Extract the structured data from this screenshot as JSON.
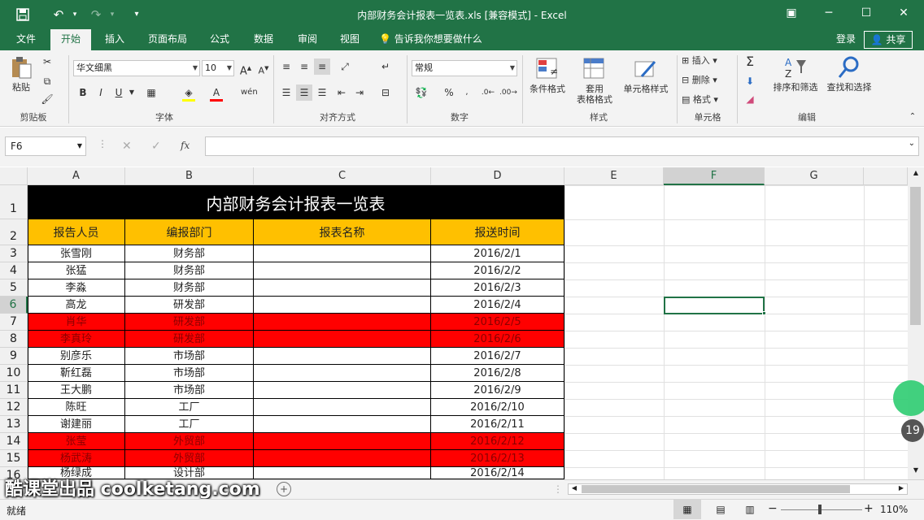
{
  "title": "内部财务会计报表一览表.xls  [兼容模式] - Excel",
  "tabs": [
    "文件",
    "开始",
    "插入",
    "页面布局",
    "公式",
    "数据",
    "审阅",
    "视图"
  ],
  "tell_me": "告诉我你想要做什么",
  "login": "登录",
  "share": "共享",
  "ribbon": {
    "paste": "粘贴",
    "clipboard": "剪贴板",
    "font_name": "华文细黑",
    "font_size": "10",
    "font_group": "字体",
    "align_group": "对齐方式",
    "number_format": "常规",
    "number_group": "数字",
    "cond_format": "条件格式",
    "table_format_1": "套用",
    "table_format_2": "表格格式",
    "cell_style": "单元格样式",
    "style_group": "样式",
    "insert": "插入",
    "delete": "删除",
    "format": "格式",
    "cells_group": "单元格",
    "sort_filter": "排序和筛选",
    "find_select": "查找和选择",
    "edit_group": "编辑",
    "bold": "B",
    "italic": "I",
    "underline": "U",
    "wen": "wén"
  },
  "name_box": "F6",
  "fx": "fx",
  "columns": [
    "A",
    "B",
    "C",
    "D",
    "E",
    "F",
    "G"
  ],
  "rows": [
    "1",
    "2",
    "3",
    "4",
    "5",
    "6",
    "7",
    "8",
    "9",
    "10",
    "11",
    "12",
    "13",
    "14",
    "15",
    "16"
  ],
  "sheet": {
    "title": "内部财务会计报表一览表",
    "headers": [
      "报告人员",
      "编报部门",
      "报表名称",
      "报送时间"
    ],
    "data": [
      {
        "name": "张雪刚",
        "dept": "财务部",
        "date": "2016/2/1",
        "red": false
      },
      {
        "name": "张猛",
        "dept": "财务部",
        "date": "2016/2/2",
        "red": false
      },
      {
        "name": "李淼",
        "dept": "财务部",
        "date": "2016/2/3",
        "red": false
      },
      {
        "name": "高龙",
        "dept": "研发部",
        "date": "2016/2/4",
        "red": false
      },
      {
        "name": "肖华",
        "dept": "研发部",
        "date": "2016/2/5",
        "red": true
      },
      {
        "name": "李真玲",
        "dept": "研发部",
        "date": "2016/2/6",
        "red": true
      },
      {
        "name": "别彦乐",
        "dept": "市场部",
        "date": "2016/2/7",
        "red": false
      },
      {
        "name": "靳红磊",
        "dept": "市场部",
        "date": "2016/2/8",
        "red": false
      },
      {
        "name": "王大鹏",
        "dept": "市场部",
        "date": "2016/2/9",
        "red": false
      },
      {
        "name": "陈旺",
        "dept": "工厂",
        "date": "2016/2/10",
        "red": false
      },
      {
        "name": "谢建丽",
        "dept": "工厂",
        "date": "2016/2/11",
        "red": false
      },
      {
        "name": "张莹",
        "dept": "外贸部",
        "date": "2016/2/12",
        "red": true
      },
      {
        "name": "杨武涛",
        "dept": "外贸部",
        "date": "2016/2/13",
        "red": true
      },
      {
        "name": "杨绿成",
        "dept": "设计部",
        "date": "2016/2/14",
        "red": false
      }
    ]
  },
  "watermark": "酷课堂出品 coolketang.com",
  "badge": "19",
  "status": "就绪",
  "zoom": "110%",
  "colors": {
    "excel_green": "#217346",
    "header_gold": "#ffc000",
    "red_row": "#ff0000",
    "title_bg": "#000000"
  }
}
